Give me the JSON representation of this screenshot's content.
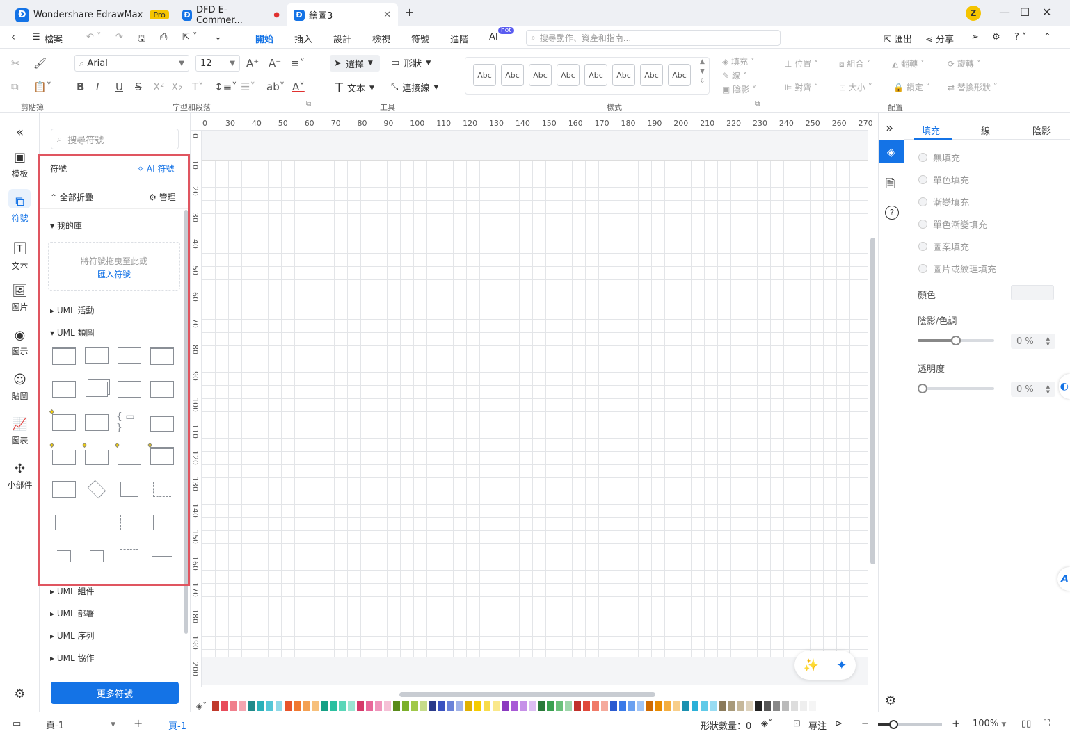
{
  "titlebar": {
    "tabs": [
      {
        "label": "Wondershare EdrawMax",
        "badge": "Pro"
      },
      {
        "label": "DFD E-Commer..."
      },
      {
        "label": "繪圖3"
      }
    ],
    "avatar": "Z"
  },
  "menu": {
    "file": "檔案",
    "items": [
      "開始",
      "插入",
      "設計",
      "檢視",
      "符號",
      "進階",
      "AI"
    ],
    "ai_badge": "hot",
    "search_placeholder": "搜尋動作、資產和指南...",
    "export": "匯出",
    "share": "分享"
  },
  "ribbon": {
    "font_name": "Arial",
    "font_size": "12",
    "select": "選擇",
    "shape": "形狀",
    "text": "文本",
    "connector": "連接線",
    "styles": [
      "Abc",
      "Abc",
      "Abc",
      "Abc",
      "Abc",
      "Abc",
      "Abc",
      "Abc"
    ],
    "fill": "填充",
    "line": "線",
    "shadow": "陰影",
    "position": "位置",
    "group": "組合",
    "flip": "翻轉",
    "rotate": "旋轉",
    "align": "對齊",
    "size": "大小",
    "lock": "鎖定",
    "replace": "替換形狀",
    "groups": {
      "clipboard": "剪貼簿",
      "font": "字型和段落",
      "tools": "工具",
      "style": "樣式",
      "arrange": "配置"
    }
  },
  "leftnav": [
    "模板",
    "符號",
    "文本",
    "圖片",
    "圖示",
    "貼圖",
    "圖表",
    "小部件"
  ],
  "symbols": {
    "search_placeholder": "搜尋符號",
    "title": "符號",
    "ai_symbols": "AI 符號",
    "collapse_all": "全部折疊",
    "manage": "管理",
    "my_library": "我的庫",
    "drop_hint": "將符號拖曳至此或",
    "import": "匯入符號",
    "categories_top": [
      "UML 活動",
      "UML 類圖"
    ],
    "categories_bottom": [
      "UML 組件",
      "UML 部署",
      "UML 序列",
      "UML 協作"
    ],
    "more": "更多符號"
  },
  "ruler": {
    "top": [
      "0",
      "30",
      "40",
      "50",
      "60",
      "70",
      "80",
      "90",
      "100",
      "110",
      "120",
      "130",
      "140",
      "150",
      "160",
      "170",
      "180",
      "190",
      "200",
      "210",
      "220",
      "230",
      "240",
      "250",
      "260",
      "270"
    ],
    "left": [
      "0",
      "10",
      "20",
      "30",
      "40",
      "50",
      "60",
      "70",
      "80",
      "90",
      "100",
      "110",
      "120",
      "130",
      "140",
      "150",
      "160",
      "170",
      "180",
      "190",
      "200"
    ]
  },
  "rightpanel": {
    "tabs": [
      "填充",
      "線",
      "陰影"
    ],
    "options": [
      "無填充",
      "單色填充",
      "漸變填充",
      "單色漸變填充",
      "圖案填充",
      "圖片或紋理填充"
    ],
    "color_label": "顏色",
    "shade_label": "陰影/色調",
    "shade_value": "0 %",
    "transparency_label": "透明度",
    "transparency_value": "0 %"
  },
  "statusbar": {
    "page_select": "頁-1",
    "page_tab": "頁-1",
    "shape_count": "形狀數量：0",
    "focus": "專注",
    "zoom": "100%"
  },
  "colors": {
    "accent": "#1473e6",
    "selection": "#e05560"
  }
}
